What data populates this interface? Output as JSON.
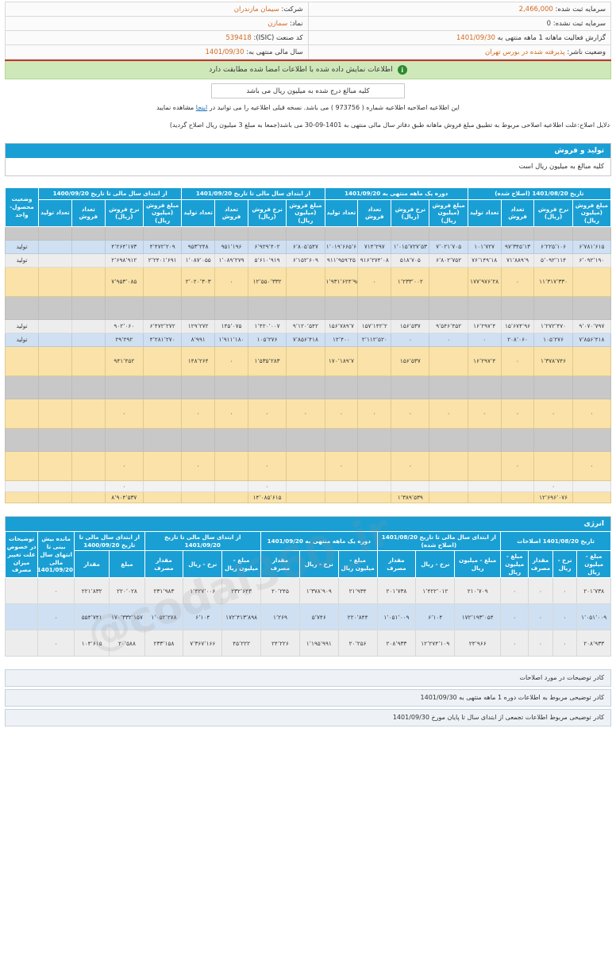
{
  "header": {
    "company_label": "شرکت:",
    "company_value": "سیمان مازندران",
    "capital_registered_label": "سرمایه ثبت شده:",
    "capital_registered_value": "2,466,000",
    "symbol_label": "نماد:",
    "symbol_value": "سمازن",
    "capital_unregistered_label": "سرمایه ثبت نشده:",
    "capital_unregistered_value": "0",
    "isic_label": "کد صنعت (ISIC):",
    "isic_value": "539418",
    "report_label": "گزارش فعالیت ماهانه  1 ماهه منتهی به",
    "report_value": "1401/09/30",
    "fiscal_label": "سال مالی منتهی به:",
    "fiscal_value": "1401/09/30",
    "status_label": "وضعیت ناشر:",
    "status_value": "پذیرفته شده در بورس تهران",
    "confirm_banner": "اطلاعات نمایش داده شده با اطلاعات امضا شده مطابقت دارد",
    "info_icon": "info-icon"
  },
  "notice": {
    "unit_box": "کلیه مبالغ درج شده به میلیون ریال می باشد",
    "amend_prefix": "این اطلاعیه اصلاحیه اطلاعیه شماره (",
    "amend_number": "973756",
    "amend_mid": ") می باشد. نسخه قبلی اطلاعیه را می توانید در",
    "amend_link": "اینجا",
    "amend_suffix": "مشاهده نمایید",
    "reason": "دلایل اصلاح:علت اطلاعیه اصلاحی مربوط به تطبیق مبلغ فروش ماهانه طبق دفاتر سال مالی منتهی به 1401-09-30 می باشد(جمعا به مبلغ 3 میلیون ریال اصلاح گردید)"
  },
  "production_section": {
    "title": "تولید و فروش",
    "subtitle": "کلیه مبالغ به میلیون ریال است"
  },
  "production_table": {
    "group_headers": [
      "تاریخ 1401/08/20 (اصلاح شده)",
      "دوره یک ماهه منتهی به 1401/09/20",
      "از ابتدای سال مالی تا تاریخ 1401/09/20",
      "از ابتدای سال مالی تا تاریخ 1400/09/20"
    ],
    "status_col": "وضعیت محصول- واحد",
    "sub_headers": [
      "تعداد تولید",
      "تعداد فروش",
      "نرخ فروش (ریال)",
      "مبلغ فروش (میلیون ریال)"
    ],
    "rows": [
      {
        "style": "r-gray",
        "status": "",
        "cells": [
          "",
          "",
          "",
          "",
          "",
          "",
          "",
          "",
          "",
          "",
          "",
          "",
          "",
          "",
          "",
          ""
        ]
      },
      {
        "style": "r-blue",
        "status": "تولید",
        "cells": [
          "۶٬۷۸۱٬۶۱۵",
          "۶٬۲۲۵٬۱۰۶",
          "۹۷٬۳۴۵٬۱۳",
          "۱۰۱٬۷۲۷",
          "۷٬۰۲۱٬۷۰۵",
          "۱٬۰۱۵٬۷۲۷٬۵۳",
          "۷۱۴٬۲۹۷",
          "۱٬۰۱۹٬۶۶۵٬۶",
          "۶٬۸۰۵٬۵۴۷",
          "۶٬۹۲۹٬۴۰۲",
          "۹۵۱٬۱۹۶",
          "۹۵۳٬۲۴۸",
          "۴٬۴۷۲٬۲۰۹",
          "۴٬۲۶۴٬۱۷۳",
          "",
          ""
        ]
      },
      {
        "style": "r-white",
        "status": "تولید",
        "cells": [
          "۶٬۰۹۲٬۱۹۰",
          "۵٬۰۹۲٬۱۱۴",
          "۷۱٬۸۸۹٬۹",
          "۷۶٬۱۴۹٬۱۸",
          "۶٬۸۰۲٬۷۵۲",
          "۵۱۸٬۷۰۵",
          "۹۱۶٬۲۷۴٬۰۸",
          "۹۱۱٬۹۵۹٬۲۵",
          "۶٬۱۵۲٬۶۰۹",
          "۵٬۶۱۰٬۹۱۹",
          "۱٬۰۸۹٬۲۷۹",
          "۱٬۰۸۷٬۰۵۵",
          "۲٬۲۴۰۱٬۶۹۱",
          "۲٬۶۹۸٬۹۱۲",
          "",
          ""
        ]
      },
      {
        "style": "r-amber tall",
        "status": "",
        "cells": [
          "",
          "۱۱٬۳۱۷٬۳۳۰",
          "۰",
          "۱۷۷٬۹۷۶٬۲۸",
          "",
          "۱٬۲۳۳٬۰۰۲",
          "۰",
          "۱٬۹۳۱٬۶۲۴٬۹۵",
          "",
          "۱۲٬۵۵۰٬۳۳۲",
          "۰",
          "۲٬۰۲۰٬۳۰۳",
          "",
          "۷٬۹۵۳٬۰۸۵",
          "",
          ""
        ]
      },
      {
        "style": "r-gray tall2",
        "status": "",
        "cells": [
          "",
          "",
          "",
          "",
          "",
          "",
          "",
          "",
          "",
          "",
          "",
          "",
          "",
          "",
          "",
          ""
        ]
      },
      {
        "style": "r-white",
        "status": "تولید",
        "cells": [
          "۹٬۰۷۰٬۷۹۷",
          "۱٬۲۷۲٬۴۷۰",
          "۱۵٬۶۷۴٬۹۶",
          "۱۶٬۲۹۷٬۴",
          "۹٬۵۴۶٬۴۵۲",
          "۱۵۶٬۵۳۷",
          "۱۵۷٬۱۴۲٬۲",
          "۱۵۶٬۷۸۹٬۷",
          "۹٬۱۲۰٬۵۴۲",
          "۱٬۴۲۰٬۰۰۷",
          "۱۴۵٬۰۷۵",
          "۱۲۹٬۲۷۲",
          "۶٬۴۷۲٬۲۷۲",
          "۹۰۲٬۰۶۰",
          "",
          ""
        ]
      },
      {
        "style": "r-blue",
        "status": "تولید",
        "cells": [
          "۷٬۸۵۶٬۴۱۸",
          "۱۰۵٬۲۷۶",
          "۲۰۸٬۰۶۰",
          "۰",
          "۰",
          "۰",
          "۲٬۱۱۲٬۵۲۰",
          "۱۲٬۴۰۰",
          "۷٬۸۵۶٬۴۱۸",
          "۱۰۵٬۲۷۶",
          "۱٬۹۱۱٬۱۸۰",
          "۸٬۹۹۱",
          "۴٬۲۸۱٬۲۷۰",
          "۲۹٬۲۹۲",
          "",
          ""
        ]
      },
      {
        "style": "r-amber tall",
        "status": "",
        "cells": [
          "",
          "۱٬۳۷۸٬۷۴۶",
          "۰",
          "۱۶٬۲۹۷٬۴",
          "",
          "۱۵۶٬۵۳۷",
          "",
          "۱۷۰٬۱۸۹٬۷",
          "",
          "۱٬۵۳۵٬۲۸۳",
          "۰",
          "۱۴۸٬۲۶۴",
          "",
          "۹۴۱٬۴۵۲",
          "",
          ""
        ]
      },
      {
        "style": "r-gray tall2",
        "status": "",
        "cells": [
          "",
          "",
          "",
          "",
          "",
          "",
          "",
          "",
          "",
          "",
          "",
          "",
          "",
          "",
          "",
          ""
        ]
      },
      {
        "style": "r-amber tall",
        "status": "",
        "cells": [
          "۰",
          "۰",
          "۰",
          "۰",
          "۰",
          "۰",
          "۰",
          "۰",
          "۰",
          "۰",
          "۰",
          "۰",
          "",
          "۰",
          "",
          ""
        ]
      },
      {
        "style": "r-gray tall2",
        "status": "",
        "cells": [
          "",
          "",
          "",
          "",
          "",
          "",
          "",
          "",
          "",
          "",
          "",
          "",
          "",
          "",
          "",
          ""
        ]
      },
      {
        "style": "r-amber tall",
        "status": "",
        "cells": [
          "۰",
          "",
          "۰",
          "",
          "",
          "۰",
          "",
          "۰",
          "",
          "۰",
          "",
          "۰",
          "",
          "۰",
          "",
          ""
        ]
      },
      {
        "style": "r-light short",
        "status": "",
        "cells": [
          "",
          "۰",
          "",
          "",
          "",
          "",
          "",
          "",
          "",
          "۰",
          "",
          "",
          "",
          "۰",
          "",
          ""
        ]
      },
      {
        "style": "r-amber short",
        "status": "",
        "cells": [
          "",
          "۱۲٬۶۹۶٬۰۷۶",
          "",
          "",
          "",
          "۱٬۳۸۹٬۵۳۹",
          "",
          "",
          "",
          "۱۴٬۰۸۵٬۶۱۵",
          "",
          "",
          "",
          "۸٬۹۰۴٬۵۳۷",
          "",
          ""
        ]
      }
    ]
  },
  "energy_section": {
    "title": "انرژی"
  },
  "energy_table": {
    "group_headers": [
      "تاریخ 1401/08/20 اصلاحات",
      "از ابتدای سال مالی تا تاریخ 1401/08/20 (اصلاح شده)",
      "دوره یک ماهه منتهی به 1401/09/20",
      "از ابتدای سال مالی تا تاریخ 1401/09/20",
      "از ابتدای سال مالی تا تاریخ 1400/09/20"
    ],
    "col_remain": "مانده بیش بینی تا انتهای سال مالی 1401/09/20",
    "col_notes": "توضیحات در خصوص علت تغییر میزان مصرف",
    "sub_headers": [
      "مقدار مصرف",
      "نرخ - ریال",
      "مبلغ - میلیون ریال"
    ],
    "sub_amount": "مقدار",
    "sub_sum": "مبلغ",
    "sub_consume": "مقدار مصرف",
    "rows": [
      {
        "style": "e-white",
        "cells": [
          "۲۰۱٬۷۳۸",
          "۰",
          "۰",
          "۰",
          "۲۱۰٬۷۰۹",
          "۱٬۴۲۲٬۰۱۲",
          "۲۰۱٬۷۳۸",
          "۲۱٬۹۳۴",
          "۱٬۳۷۸٬۹۰۹",
          "۲۰٬۲۴۵",
          "۲۳۲٬۶۴۳",
          "۱٬۴۲۷٬۰۰۶",
          "۲۳۱٬۹۸۳",
          "۲۲۰٬۰۲۸",
          "۲۲۱٬۸۳۲",
          "۰",
          ""
        ]
      },
      {
        "style": "e-blue",
        "cells": [
          "۱٬۰۵۱٬۰۰۹",
          "۰",
          "۰",
          "۰",
          "۱۷۲٬۱۹۳٬۰۵۴",
          "۶٬۱۰۴",
          "۱٬۰۵۱٬۰۰۹",
          "۲۲۰٬۸۴۴",
          "۵٬۷۴۶",
          "۱٬۲۶۹",
          "۱۷۲٬۴۱۳٬۸۹۸",
          "۶٬۱۰۴",
          "۱٬۰۵۲٬۲۷۸",
          "۱۷۰٬۳۳۲٬۱۵۷",
          "۵۵۴٬۷۴۱",
          "۰",
          ""
        ]
      },
      {
        "style": "e-gray",
        "cells": [
          "۲۰۸٬۹۳۳",
          "۰",
          "۰",
          "۰",
          "۲۴٬۹۶۶",
          "۱۲٬۲۷۴٬۱۰۹",
          "۲۰۸٬۹۳۳",
          "۲۰٬۲۵۶",
          "۱٬۱۹۵٬۹۹۱",
          "۲۴٬۲۲۶",
          "۴۵٬۲۲۲",
          "۷٬۳۶۷٬۱۶۶",
          "۲۳۳٬۱۵۸",
          "۲۰٬۵۸۸",
          "۱۰۴٬۶۱۵",
          "۰",
          ""
        ]
      }
    ]
  },
  "footer_notes": [
    "کادر توضیحات در مورد اصلاحات",
    "کادر توضیحی مربوط به اطلاعات دوره 1 ماهه منتهی به 1401/09/30",
    "کادر توضیحی مربوط اطلاعات تجمعی از ابتدای سال تا پایان مورخ 1401/09/30"
  ],
  "watermark": "@codal360_ir"
}
